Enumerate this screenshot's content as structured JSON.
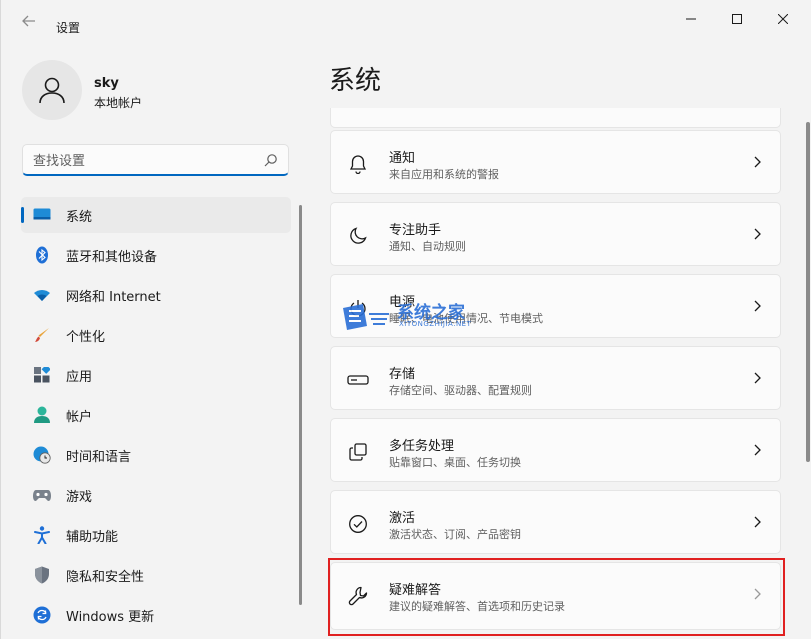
{
  "window": {
    "title": "设置",
    "back_icon": "arrow-left-icon",
    "controls": [
      "minimize-icon",
      "maximize-icon",
      "close-icon"
    ]
  },
  "profile": {
    "name": "sky",
    "account_type": "本地帐户"
  },
  "search": {
    "placeholder": "查找设置"
  },
  "sidebar": {
    "items": [
      {
        "label": "系统",
        "icon": "monitor-icon",
        "active": true
      },
      {
        "label": "蓝牙和其他设备",
        "icon": "bluetooth-icon"
      },
      {
        "label": "网络和 Internet",
        "icon": "wifi-icon"
      },
      {
        "label": "个性化",
        "icon": "brush-icon"
      },
      {
        "label": "应用",
        "icon": "apps-icon"
      },
      {
        "label": "帐户",
        "icon": "person-icon"
      },
      {
        "label": "时间和语言",
        "icon": "globe-clock-icon"
      },
      {
        "label": "游戏",
        "icon": "gamepad-icon"
      },
      {
        "label": "辅助功能",
        "icon": "accessibility-icon"
      },
      {
        "label": "隐私和安全性",
        "icon": "shield-icon"
      },
      {
        "label": "Windows 更新",
        "icon": "update-icon"
      }
    ]
  },
  "main": {
    "title": "系统",
    "cards": [
      {
        "title": "通知",
        "subtitle": "来自应用和系统的警报",
        "icon": "bell-icon"
      },
      {
        "title": "专注助手",
        "subtitle": "通知、自动规则",
        "icon": "moon-icon"
      },
      {
        "title": "电源",
        "subtitle": "睡眠、电池使用情况、节电模式",
        "icon": "power-icon"
      },
      {
        "title": "存储",
        "subtitle": "存储空间、驱动器、配置规则",
        "icon": "storage-icon"
      },
      {
        "title": "多任务处理",
        "subtitle": "贴靠窗口、桌面、任务切换",
        "icon": "multitask-icon"
      },
      {
        "title": "激活",
        "subtitle": "激活状态、订阅、产品密钥",
        "icon": "check-circle-icon"
      },
      {
        "title": "疑难解答",
        "subtitle": "建议的疑难解答、首选项和历史记录",
        "icon": "wrench-icon"
      }
    ]
  },
  "watermark": {
    "text": "系统之家",
    "sub": "XITONGZHIJIA.NET"
  },
  "colors": {
    "accent": "#0067c0",
    "highlight": "#e02020"
  }
}
